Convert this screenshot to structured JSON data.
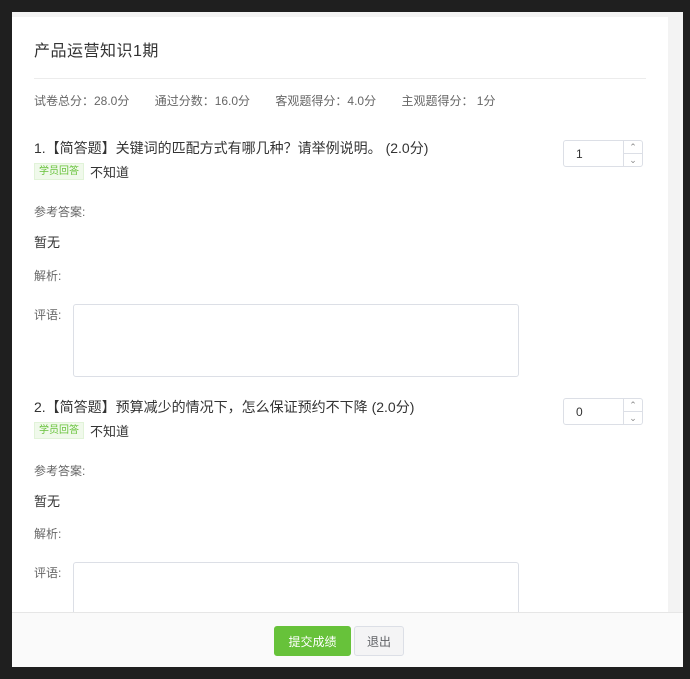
{
  "exam": {
    "title": "产品运营知识1期",
    "scores": {
      "total": "试卷总分：28.0分",
      "pass": "通过分数：16.0分",
      "objective": "客观题得分：4.0分",
      "subjective": "主观题得分： 1分"
    }
  },
  "questions": [
    {
      "title": "1.【简答题】关键词的匹配方式有哪几种？请举例说明。 (2.0分)",
      "answer_tag": "学员回答",
      "answer": "不知道",
      "ref_label": "参考答案:",
      "ref_value": "暂无",
      "analysis_label": "解析:",
      "comment_label": "评语:",
      "score": "1"
    },
    {
      "title": "2.【简答题】预算减少的情况下，怎么保证预约不下降 (2.0分)",
      "answer_tag": "学员回答",
      "answer": "不知道",
      "ref_label": "参考答案:",
      "ref_value": "暂无",
      "analysis_label": "解析:",
      "comment_label": "评语:",
      "score": "0"
    }
  ],
  "footer": {
    "submit_label": "提交成绩",
    "exit_label": "退出"
  },
  "colors": {
    "accent": "#67c23a",
    "tag_bg": "#f0f9eb"
  },
  "icons": {
    "up": "chevron-up-icon",
    "down": "chevron-down-icon"
  }
}
